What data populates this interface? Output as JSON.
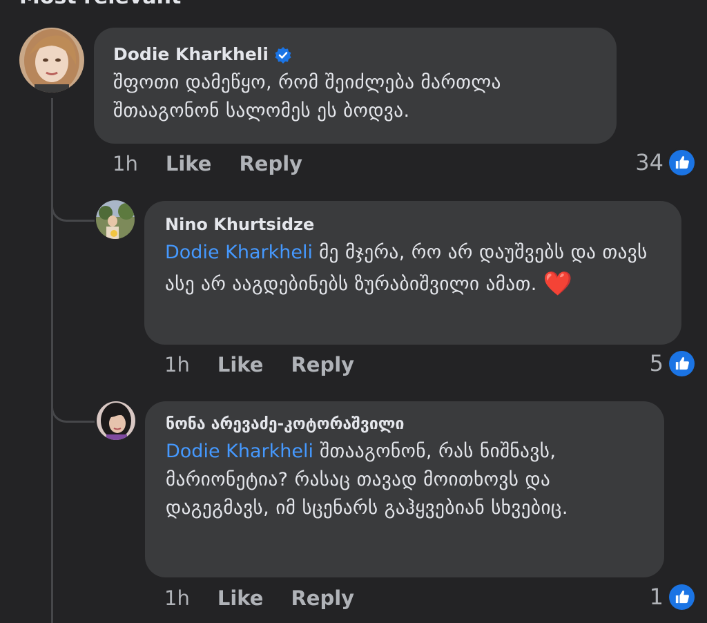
{
  "header": {
    "title": "Most relevant"
  },
  "comments": [
    {
      "author": "Dodie Kharkheli",
      "verified": true,
      "text": "შფოთი დამეწყო, რომ შეიძლება მართლა შთააგონონ სალომეს ეს ბოდვა.",
      "time": "1h",
      "like_label": "Like",
      "reply_label": "Reply",
      "reactions": "34",
      "reaction_icon": "thumbs-up-icon"
    },
    {
      "author": "Nino Khurtsidze",
      "mention": "Dodie Kharkheli",
      "text": " მე მჯერა, რო არ დაუშვებს და თავს ასე არ ააგდებინებს ზურაბიშვილი ამათ. ",
      "emoji": "❤️",
      "time": "1h",
      "like_label": "Like",
      "reply_label": "Reply",
      "reactions": "5",
      "reaction_icon": "thumbs-up-icon"
    },
    {
      "author": "ნონა არევაძე-კოტორაშვილი",
      "mention": "Dodie Kharkheli",
      "text": " შთააგონონ, რას ნიშნავს, მარიონეტია? რასაც თავად მოითხოვს და დაგეგმავს, იმ სცენარს გაჰყვებიან სხვებიც.",
      "time": "1h",
      "like_label": "Like",
      "reply_label": "Reply",
      "reactions": "1",
      "reaction_icon": "thumbs-up-icon"
    }
  ],
  "colors": {
    "background": "#232325",
    "bubble": "#3a3b3d",
    "mention": "#4599ff",
    "like_badge": "#1b74e4",
    "verified": "#1b74e4"
  }
}
